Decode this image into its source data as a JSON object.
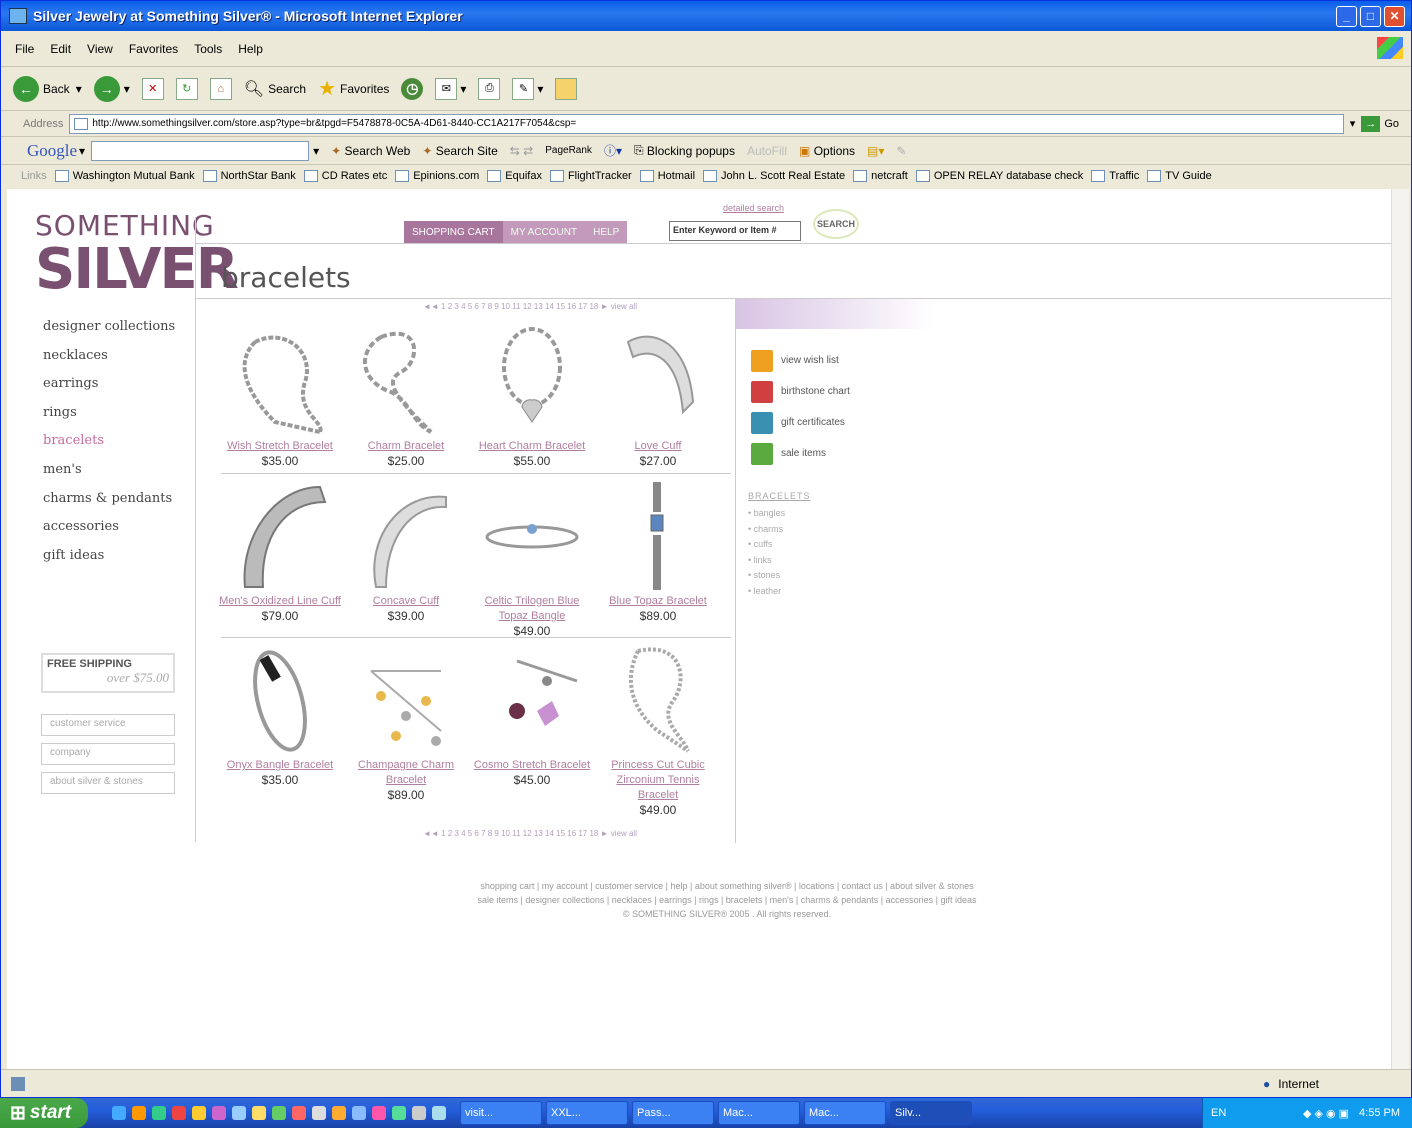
{
  "window": {
    "title": "Silver Jewelry at Something Silver® - Microsoft Internet Explorer"
  },
  "menu": [
    "File",
    "Edit",
    "View",
    "Favorites",
    "Tools",
    "Help"
  ],
  "toolbar": {
    "back": "Back",
    "search": "Search",
    "favorites": "Favorites"
  },
  "address": {
    "label": "Address",
    "url": "http://www.somethingsilver.com/store.asp?type=br&tpgd=F5478878-0C5A-4D61-8440-CC1A217F7054&csp=",
    "go": "Go"
  },
  "google": {
    "logo": "Google",
    "search_web": "Search Web",
    "search_site": "Search Site",
    "pagerank": "PageRank",
    "blocking": "Blocking popups",
    "autofill": "AutoFill",
    "options": "Options"
  },
  "links": {
    "label": "Links",
    "items": [
      "Washington Mutual Bank",
      "NorthStar Bank",
      "CD Rates etc",
      "Epinions.com",
      "Equifax",
      "FlightTracker",
      "Hotmail",
      "John L. Scott Real Estate",
      "netcraft",
      "OPEN RELAY database check",
      "Traffic",
      "TV Guide"
    ]
  },
  "site": {
    "logo_line1": "SOMETHING",
    "logo_line2": "SILVER",
    "detailed_search": "detailed search",
    "tabs": [
      "SHOPPING CART",
      "MY ACCOUNT",
      "HELP"
    ],
    "keyword_placeholder": "Enter Keyword or Item #",
    "search_button": "SEARCH",
    "page_title": "bracelets",
    "nav": [
      "designer collections",
      "necklaces",
      "earrings",
      "rings",
      "bracelets",
      "men's",
      "charms & pendants",
      "accessories",
      "gift ideas"
    ],
    "free_shipping": "FREE SHIPPING",
    "free_shipping_sub": "over $75.00",
    "side_boxes": [
      "customer service",
      "company",
      "about silver & stones"
    ],
    "pager": "◄◄ 1 2 3 4 5 6 7 8 9 10 11 12 13 14 15 16 17 18 ►  view all",
    "products": [
      {
        "name": "Wish Stretch Bracelet",
        "price": "$35.00"
      },
      {
        "name": "Charm Bracelet",
        "price": "$25.00"
      },
      {
        "name": "Heart Charm Bracelet",
        "price": "$55.00"
      },
      {
        "name": "Love Cuff",
        "price": "$27.00"
      },
      {
        "name": "Men's Oxidized Line Cuff",
        "price": "$79.00"
      },
      {
        "name": "Concave Cuff",
        "price": "$39.00"
      },
      {
        "name": "Celtic Trilogen Blue Topaz Bangle",
        "price": "$49.00"
      },
      {
        "name": "Blue Topaz Bracelet",
        "price": "$89.00"
      },
      {
        "name": "Onyx Bangle Bracelet",
        "price": "$35.00"
      },
      {
        "name": "Champagne Charm Bracelet",
        "price": "$89.00"
      },
      {
        "name": "Cosmo Stretch Bracelet",
        "price": "$45.00"
      },
      {
        "name": "Princess Cut Cubic Zirconium Tennis Bracelet",
        "price": "$49.00"
      }
    ],
    "side_links": [
      "view wish list",
      "birthstone chart",
      "gift certificates",
      "sale items"
    ],
    "bracelets_head": "BRACELETS",
    "bracelets_list": [
      "bangles",
      "charms",
      "cuffs",
      "links",
      "stones",
      "leather"
    ],
    "footer_line1": "shopping cart | my account | customer service | help | about something silver® | locations | contact us | about silver & stones",
    "footer_line2": "sale items | designer collections | necklaces | earrings | rings | bracelets | men's | charms & pendants | accessories | gift ideas",
    "footer_line3": "© SOMETHING SILVER® 2005 . All rights reserved."
  },
  "status": {
    "zone": "Internet"
  },
  "taskbar": {
    "start": "start",
    "tasks": [
      "visit...",
      "XXL...",
      "Pass...",
      "Mac...",
      "Mac...",
      "Silv..."
    ],
    "lang": "EN",
    "time": "4:55 PM"
  },
  "colors": {
    "accent_purple": "#7a5070",
    "link": "#b07fa0",
    "tab_bg": "#b47aa8"
  }
}
